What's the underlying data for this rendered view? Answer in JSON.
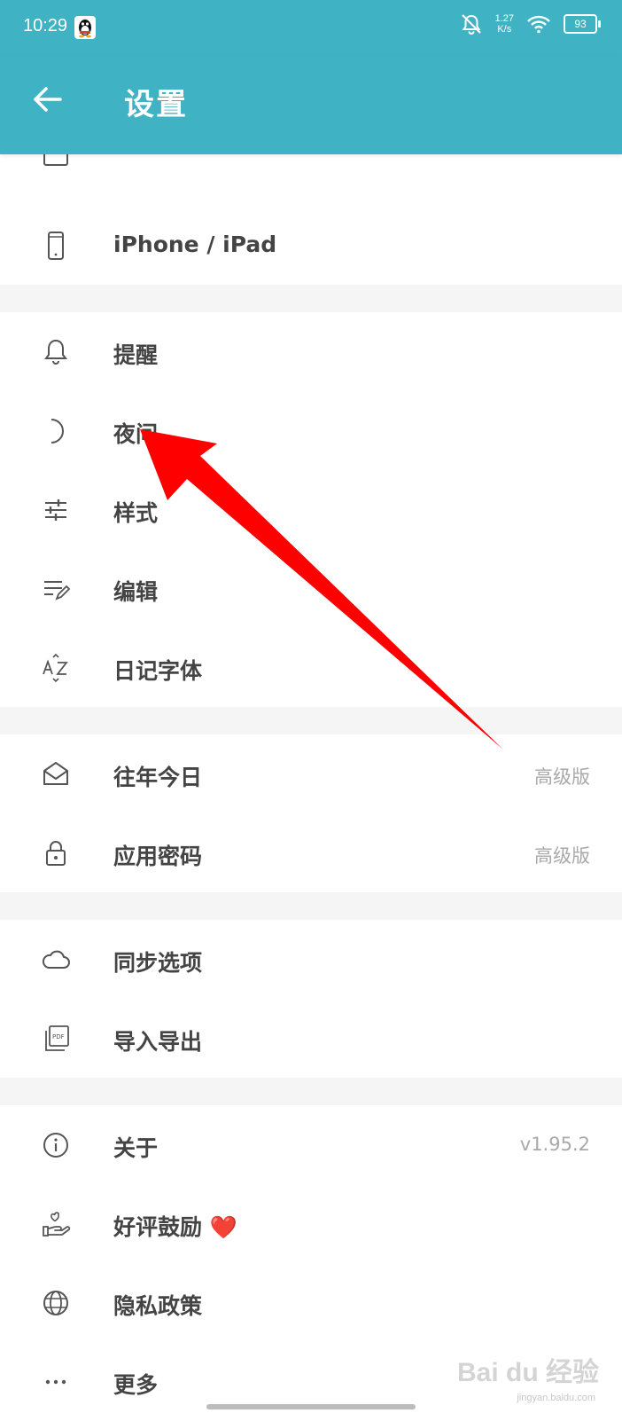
{
  "status_bar": {
    "time": "10:29",
    "net_speed_value": "1.27",
    "net_speed_unit": "K/s",
    "battery": "93"
  },
  "app_bar": {
    "title": "设置"
  },
  "groups": [
    {
      "rows": [
        {
          "label": "iPhone / iPad",
          "icon": "phone-icon",
          "value": ""
        }
      ]
    },
    {
      "rows": [
        {
          "label": "提醒",
          "icon": "bell-icon",
          "value": ""
        },
        {
          "label": "夜间",
          "icon": "moon-icon",
          "value": ""
        },
        {
          "label": "样式",
          "icon": "sliders-icon",
          "value": ""
        },
        {
          "label": "编辑",
          "icon": "edit-lines-icon",
          "value": ""
        },
        {
          "label": "日记字体",
          "icon": "font-az-icon",
          "value": ""
        }
      ]
    },
    {
      "rows": [
        {
          "label": "往年今日",
          "icon": "mail-open-icon",
          "value": "高级版"
        },
        {
          "label": "应用密码",
          "icon": "lock-icon",
          "value": "高级版"
        }
      ]
    },
    {
      "rows": [
        {
          "label": "同步选项",
          "icon": "cloud-icon",
          "value": ""
        },
        {
          "label": "导入导出",
          "icon": "pdf-icon",
          "value": ""
        }
      ]
    },
    {
      "rows": [
        {
          "label": "关于",
          "icon": "info-icon",
          "value": "v1.95.2"
        },
        {
          "label": "好评鼓励 ❤️",
          "icon": "heart-hand-icon",
          "value": ""
        },
        {
          "label": "隐私政策",
          "icon": "globe-icon",
          "value": ""
        },
        {
          "label": "更多",
          "icon": "more-dots-icon",
          "value": ""
        }
      ]
    }
  ],
  "watermark": {
    "text": "Bai du 经验",
    "sub": "jingyan.baidu.com"
  },
  "colors": {
    "header": "#3fb3c3",
    "arrow": "#ff0000",
    "secondary_text": "#a9a9a9"
  }
}
